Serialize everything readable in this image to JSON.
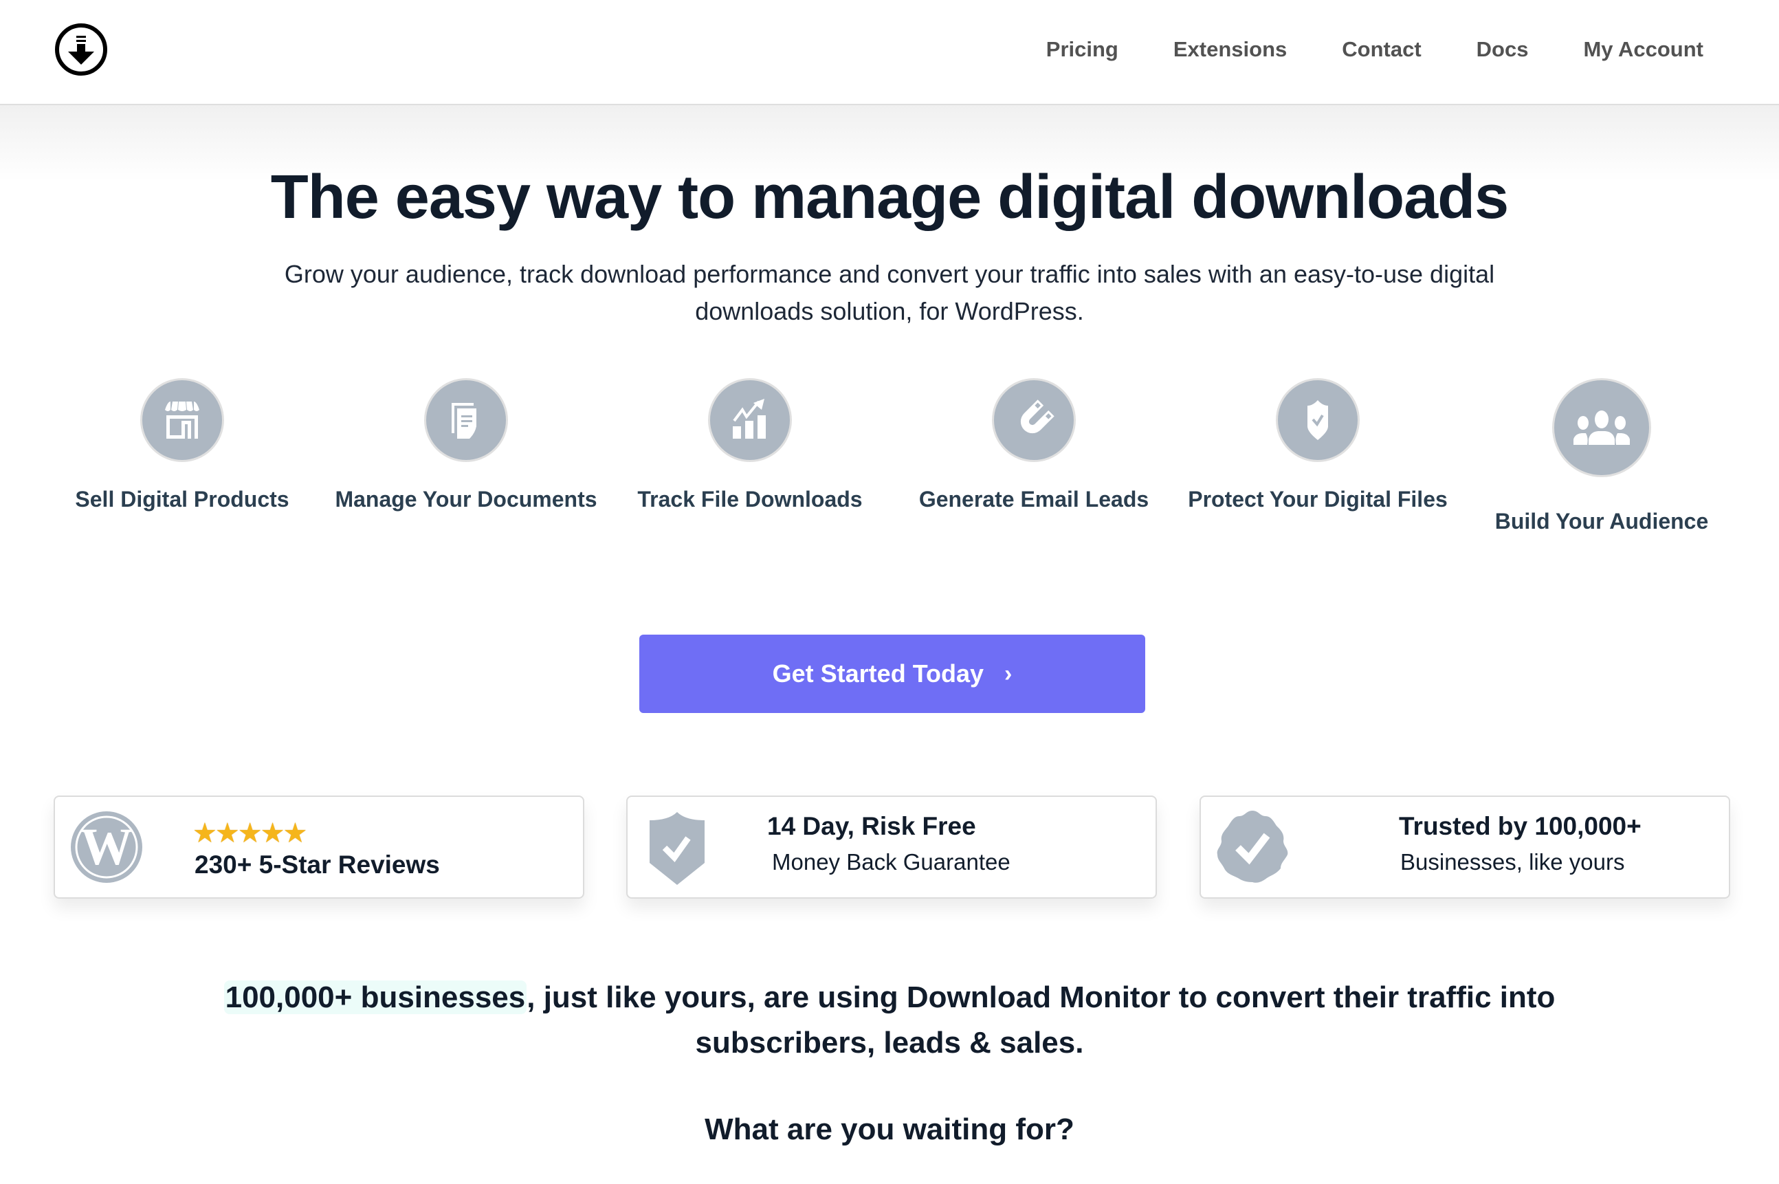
{
  "header": {
    "logo_icon": "download-circle-icon",
    "nav": [
      "Pricing",
      "Extensions",
      "Contact",
      "Docs",
      "My Account"
    ]
  },
  "hero": {
    "title": "The easy way to manage digital downloads",
    "subtitle": "Grow your audience, track download performance and convert your traffic into sales with an easy-to-use digital downloads solution, for WordPress."
  },
  "features": [
    {
      "label": "Sell Digital Products",
      "icon": "storefront-icon"
    },
    {
      "label": "Manage Your Documents",
      "icon": "documents-icon"
    },
    {
      "label": "Track File Downloads",
      "icon": "chart-growth-icon"
    },
    {
      "label": "Generate Email Leads",
      "icon": "magnet-icon"
    },
    {
      "label": "Protect Your Digital Files",
      "icon": "shield-check-icon"
    },
    {
      "label": "Build Your Audience",
      "icon": "users-group-icon"
    }
  ],
  "cta": {
    "label": "Get Started Today",
    "icon": "chevron-right-icon"
  },
  "trust": [
    {
      "icon": "wordpress-icon",
      "stars": "★★★★★",
      "rating": 5,
      "title": "230+ 5-Star Reviews"
    },
    {
      "icon": "shield-check-icon",
      "title": "14 Day, Risk Free",
      "subtitle": "Money Back Guarantee"
    },
    {
      "icon": "verified-badge-icon",
      "title": "Trusted by 100,000+",
      "subtitle": "Businesses, like yours"
    }
  ],
  "social_proof": {
    "highlight": "100,000+ businesses",
    "rest": ", just like yours, are using Download Monitor to convert their traffic into subscribers, leads & sales.",
    "question": "What are you waiting for?"
  },
  "colors": {
    "accent": "#6f6ef5",
    "icon_gray": "#adb7c2",
    "feature_text": "#2b3f50",
    "heading": "#111c2b",
    "highlight_bg": "#ecfcf9"
  }
}
